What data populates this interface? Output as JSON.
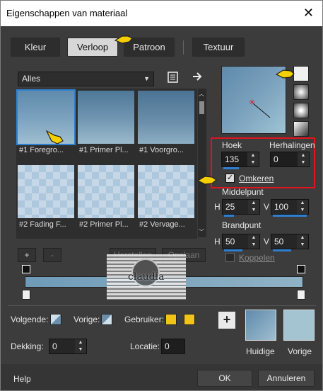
{
  "window": {
    "title": "Eigenschappen van materiaal",
    "close_glyph": "✕"
  },
  "tabs": [
    {
      "label": "Kleur"
    },
    {
      "label": "Verloop"
    },
    {
      "label": "Patroon"
    },
    {
      "label": "Textuur"
    }
  ],
  "gradient_list": {
    "category_selected": "Alles",
    "items": [
      {
        "label": "#1 Foregro..."
      },
      {
        "label": "#1 Primer Pl..."
      },
      {
        "label": "#1 Voorgro..."
      },
      {
        "label": "#2 Fading F..."
      },
      {
        "label": "#2 Primer Pl..."
      },
      {
        "label": "#2 Vervage..."
      }
    ],
    "add_label": "+",
    "remove_label": "-",
    "restore_label": "Herstellen",
    "save_label": "Opslaan"
  },
  "properties": {
    "angle_label": "Hoek",
    "angle_value": "135",
    "repeats_label": "Herhalingen",
    "repeats_value": "0",
    "invert_label": "Omkeren",
    "invert_checked": true,
    "midpoint_label": "Middelpunt",
    "h_label": "H",
    "v_label": "V",
    "mid_h_value": "25",
    "mid_v_value": "100",
    "focal_label": "Brandpunt",
    "focal_h_value": "50",
    "focal_v_value": "50",
    "link_label": "Koppelen"
  },
  "watermark": {
    "text": "claudia"
  },
  "bottom": {
    "next_label": "Volgende:",
    "prev_label": "Vorige:",
    "user_label": "Gebruiker:",
    "opacity_label": "Dekking:",
    "opacity_value": "0",
    "location_label": "Locatie:",
    "location_value": "0",
    "current_label": "Huidige",
    "previous_label": "Vorige",
    "add_label": "+",
    "user_color": "#f0c419"
  },
  "footer": {
    "help_label": "Help",
    "ok_label": "OK",
    "cancel_label": "Annuleren"
  },
  "colors": {
    "accent_blue": "#2f7fd1",
    "highlight_red": "#e0141e",
    "pointer_yellow": "#f5d000"
  }
}
